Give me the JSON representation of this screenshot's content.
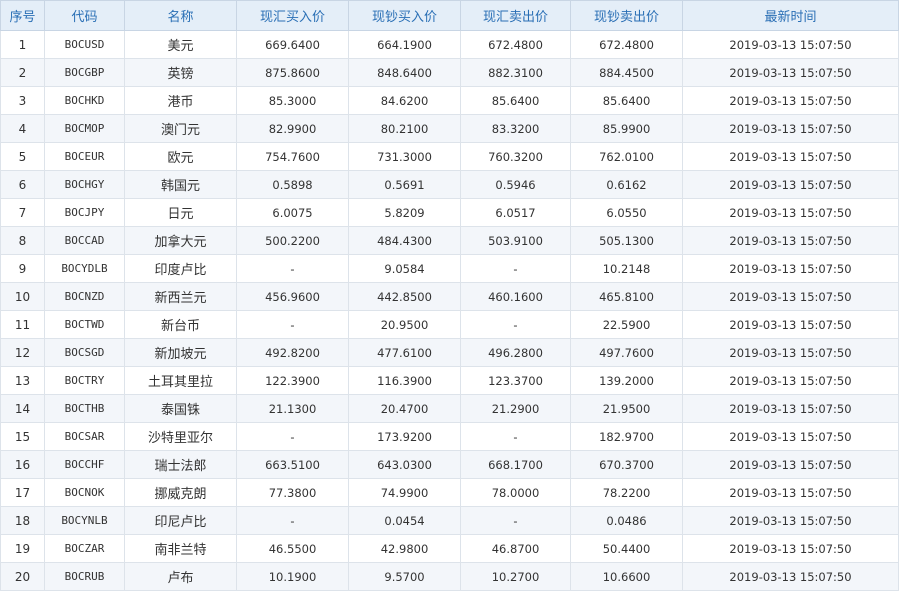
{
  "table": {
    "headers": [
      "序号",
      "代码",
      "名称",
      "现汇买入价",
      "现钞买入价",
      "现汇卖出价",
      "现钞卖出价",
      "最新时间"
    ],
    "rows": [
      [
        "1",
        "BOCUSD",
        "美元",
        "669.6400",
        "664.1900",
        "672.4800",
        "672.4800",
        "2019-03-13 15:07:50"
      ],
      [
        "2",
        "BOCGBP",
        "英镑",
        "875.8600",
        "848.6400",
        "882.3100",
        "884.4500",
        "2019-03-13 15:07:50"
      ],
      [
        "3",
        "BOCHKD",
        "港币",
        "85.3000",
        "84.6200",
        "85.6400",
        "85.6400",
        "2019-03-13 15:07:50"
      ],
      [
        "4",
        "BOCMOP",
        "澳门元",
        "82.9900",
        "80.2100",
        "83.3200",
        "85.9900",
        "2019-03-13 15:07:50"
      ],
      [
        "5",
        "BOCEUR",
        "欧元",
        "754.7600",
        "731.3000",
        "760.3200",
        "762.0100",
        "2019-03-13 15:07:50"
      ],
      [
        "6",
        "BOCHGY",
        "韩国元",
        "0.5898",
        "0.5691",
        "0.5946",
        "0.6162",
        "2019-03-13 15:07:50"
      ],
      [
        "7",
        "BOCJPY",
        "日元",
        "6.0075",
        "5.8209",
        "6.0517",
        "6.0550",
        "2019-03-13 15:07:50"
      ],
      [
        "8",
        "BOCCAD",
        "加拿大元",
        "500.2200",
        "484.4300",
        "503.9100",
        "505.1300",
        "2019-03-13 15:07:50"
      ],
      [
        "9",
        "BOCYDLB",
        "印度卢比",
        "-",
        "9.0584",
        "-",
        "10.2148",
        "2019-03-13 15:07:50"
      ],
      [
        "10",
        "BOCNZD",
        "新西兰元",
        "456.9600",
        "442.8500",
        "460.1600",
        "465.8100",
        "2019-03-13 15:07:50"
      ],
      [
        "11",
        "BOCTWD",
        "新台币",
        "-",
        "20.9500",
        "-",
        "22.5900",
        "2019-03-13 15:07:50"
      ],
      [
        "12",
        "BOCSGD",
        "新加坡元",
        "492.8200",
        "477.6100",
        "496.2800",
        "497.7600",
        "2019-03-13 15:07:50"
      ],
      [
        "13",
        "BOCTRY",
        "土耳其里拉",
        "122.3900",
        "116.3900",
        "123.3700",
        "139.2000",
        "2019-03-13 15:07:50"
      ],
      [
        "14",
        "BOCTHB",
        "泰国铢",
        "21.1300",
        "20.4700",
        "21.2900",
        "21.9500",
        "2019-03-13 15:07:50"
      ],
      [
        "15",
        "BOCSAR",
        "沙特里亚尔",
        "-",
        "173.9200",
        "-",
        "182.9700",
        "2019-03-13 15:07:50"
      ],
      [
        "16",
        "BOCCHF",
        "瑞士法郎",
        "663.5100",
        "643.0300",
        "668.1700",
        "670.3700",
        "2019-03-13 15:07:50"
      ],
      [
        "17",
        "BOCNOK",
        "挪威克朗",
        "77.3800",
        "74.9900",
        "78.0000",
        "78.2200",
        "2019-03-13 15:07:50"
      ],
      [
        "18",
        "BOCYNLB",
        "印尼卢比",
        "-",
        "0.0454",
        "-",
        "0.0486",
        "2019-03-13 15:07:50"
      ],
      [
        "19",
        "BOCZAR",
        "南非兰特",
        "46.5500",
        "42.9800",
        "46.8700",
        "50.4400",
        "2019-03-13 15:07:50"
      ],
      [
        "20",
        "BOCRUB",
        "卢布",
        "10.1900",
        "9.5700",
        "10.2700",
        "10.6600",
        "2019-03-13 15:07:50"
      ]
    ]
  },
  "colors": {
    "header_bg": "#e4eef8",
    "header_text": "#2a6fb5",
    "row_alt_bg": "#f3f6fa",
    "border": "#dde3ea"
  }
}
